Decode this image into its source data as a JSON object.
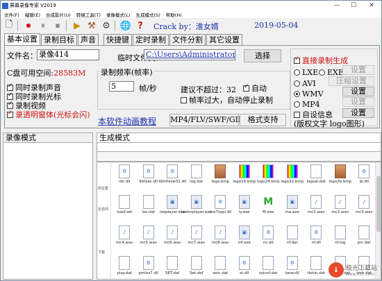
{
  "window": {
    "title": "屏幕录像专家 V2019"
  },
  "menu": [
    "文件(F)",
    "编辑(E)",
    "合成影片(U)",
    "转换工具(T)",
    "录像模式(L)",
    "生成模式(S)",
    "帮助(H)"
  ],
  "header": {
    "crack_text": "Crack by：淮女婿",
    "date": "2019-05-04"
  },
  "tabs": [
    "基本设置",
    "录制目标",
    "声音",
    "快捷键",
    "定时录制",
    "文件分割",
    "其它设置"
  ],
  "basic": {
    "filename_label": "文件名：",
    "filename_value": "录像414",
    "tempfolder_label": "临时文件夹：",
    "tempfolder_value": "C:\\Users\\Administrator\\I",
    "choose_button": "选择",
    "disk_label": "C盘可用空间:",
    "disk_value": "28583M",
    "checks": [
      {
        "label": "同时录制声音",
        "on": true
      },
      {
        "label": "同时录制光标",
        "on": true
      },
      {
        "label": "录制视频",
        "on": true
      },
      {
        "label": "录透明窗体(光标会闪)",
        "on": true
      }
    ],
    "freq_title": "录制频率(帧率)",
    "fps_value": "5",
    "fps_unit": "帧/秒",
    "suggest_text": "建议不超过：32",
    "auto_label": "自动",
    "auto_stop_label": "帧率过大，自动停止录制",
    "animation_link": "本软件动画教程",
    "format_box": "MP4/FLV/SWF/GIF",
    "format_support_button": "格式支持",
    "direct_gen_label": "直接录制生成",
    "radio_lxe": "LXE",
    "radio_exe": "EXE",
    "radio_avi": "AVI",
    "radio_wmv": "WMV",
    "radio_mp4": "MP4",
    "setting_btn": "设置",
    "compress_btn": "压缩设置",
    "selfinfo_label": "自设信息",
    "selfinfo_btn": "设置",
    "selfinfo_desc": "(版权文字 logo图形)"
  },
  "panes": {
    "left_title": "录像模式",
    "right_title": "生成模式"
  },
  "nav": [
    "的位置",
    "近访问",
    "下载"
  ],
  "files": [
    {
      "name": "idc.dll",
      "icon": "dll"
    },
    {
      "name": "libfaac.dll",
      "icon": "dll"
    },
    {
      "name": "libmfxsw32.dll",
      "icon": "dll"
    },
    {
      "name": "log.dat",
      "icon": "file"
    },
    {
      "name": "logo.bmp",
      "icon": "img"
    },
    {
      "name": "logo16.bmp",
      "icon": "bar"
    },
    {
      "name": "logo24.bmp",
      "icon": "bar"
    },
    {
      "name": "logo32.bmp",
      "icon": "bar"
    },
    {
      "name": "logoal.dat",
      "icon": "file"
    },
    {
      "name": "logo2b.bmp",
      "icon": "img"
    },
    {
      "name": "lp.dll",
      "icon": "dll"
    },
    {
      "name": "lsasf.set",
      "icon": "file"
    },
    {
      "name": "lxe.dat",
      "icon": "file"
    },
    {
      "name": "lxeplayer.exe",
      "icon": "exe"
    },
    {
      "name": "lxetmplayer.exe",
      "icon": "exe"
    },
    {
      "name": "lxw7sypl.dll",
      "icon": "dll"
    },
    {
      "name": "ly.exe",
      "icon": "exe"
    },
    {
      "name": "M.exe",
      "icon": "green"
    },
    {
      "name": "ma.exe",
      "icon": "exe"
    },
    {
      "name": "mc1.wav",
      "icon": "audio"
    },
    {
      "name": "mc2.wav",
      "icon": "audio"
    },
    {
      "name": "mc3.wav",
      "icon": "audio"
    },
    {
      "name": "mc4.wav",
      "icon": "audio"
    },
    {
      "name": "mc5.wav",
      "icon": "audio"
    },
    {
      "name": "mc6.wav",
      "icon": "audio"
    },
    {
      "name": "mc7.wav",
      "icon": "audio"
    },
    {
      "name": "mc8.wav",
      "icon": "audio"
    },
    {
      "name": "mf.exe",
      "icon": "exe"
    },
    {
      "name": "nc.dll",
      "icon": "dll"
    },
    {
      "name": "nf.dat",
      "icon": "file"
    },
    {
      "name": "nf.dll",
      "icon": "dll"
    },
    {
      "name": "nf.log",
      "icon": "file"
    },
    {
      "name": "pic.dat",
      "icon": "file"
    },
    {
      "name": "play.dat",
      "icon": "file"
    },
    {
      "name": "pmlxz7.dll",
      "icon": "dll"
    },
    {
      "name": "SET.dat",
      "icon": "file"
    },
    {
      "name": "Set.def",
      "icon": "file"
    },
    {
      "name": "setc.dat",
      "icon": "file"
    },
    {
      "name": "st.dll",
      "icon": "dll"
    },
    {
      "name": "sxtsxf.dat",
      "icon": "file"
    },
    {
      "name": "tarw.dll",
      "icon": "dll"
    },
    {
      "name": "tishin.dat",
      "icon": "file"
    },
    {
      "name": "tishinb.dat",
      "icon": "file"
    },
    {
      "name": "tmb.dat",
      "icon": "file"
    }
  ],
  "watermark": {
    "text": "极光下载站",
    "url": "www.xz7.com"
  }
}
